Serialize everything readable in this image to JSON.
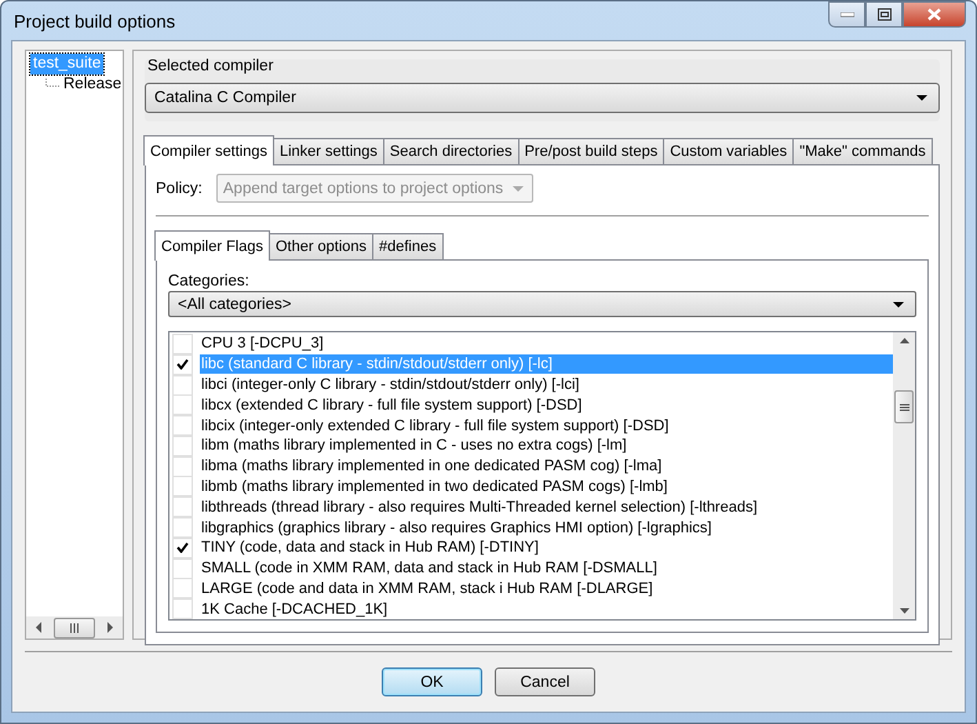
{
  "window": {
    "title": "Project build options"
  },
  "tree": [
    {
      "label": "test_suite",
      "selected": true,
      "children": [
        {
          "label": "Release",
          "selected": false
        }
      ]
    }
  ],
  "selected_compiler": {
    "label": "Selected compiler",
    "value": "Catalina C Compiler"
  },
  "tabs": [
    {
      "label": "Compiler settings",
      "selected": true
    },
    {
      "label": "Linker settings",
      "selected": false
    },
    {
      "label": "Search directories",
      "selected": false
    },
    {
      "label": "Pre/post build steps",
      "selected": false
    },
    {
      "label": "Custom variables",
      "selected": false
    },
    {
      "label": "\"Make\" commands",
      "selected": false
    }
  ],
  "policy": {
    "label": "Policy:",
    "value": "Append target options to project options",
    "disabled": true
  },
  "sub_tabs": [
    {
      "label": "Compiler Flags",
      "selected": true
    },
    {
      "label": "Other options",
      "selected": false
    },
    {
      "label": "#defines",
      "selected": false
    }
  ],
  "categories": {
    "label": "Categories:",
    "value": "<All categories>"
  },
  "flags": [
    {
      "label": "CPU 3  [-DCPU_3]",
      "checked": false,
      "selected": false
    },
    {
      "label": "libc (standard C library - stdin/stdout/stderr only)  [-lc]",
      "checked": true,
      "selected": true
    },
    {
      "label": "libci (integer-only C library - stdin/stdout/stderr only)  [-lci]",
      "checked": false,
      "selected": false
    },
    {
      "label": "libcx (extended C library - full file system support)  [-DSD]",
      "checked": false,
      "selected": false
    },
    {
      "label": "libcix (integer-only extended C library - full file system support)  [-DSD]",
      "checked": false,
      "selected": false
    },
    {
      "label": "libm (maths library implemented in C - uses no extra cogs)  [-lm]",
      "checked": false,
      "selected": false
    },
    {
      "label": "libma (maths library implemented in one dedicated PASM cog)  [-lma]",
      "checked": false,
      "selected": false
    },
    {
      "label": "libmb (maths library implemented in two dedicated PASM cogs)  [-lmb]",
      "checked": false,
      "selected": false
    },
    {
      "label": "libthreads (thread library - also requires Multi-Threaded kernel selection)  [-lthreads]",
      "checked": false,
      "selected": false
    },
    {
      "label": "libgraphics (graphics library - also requires Graphics HMI option)  [-lgraphics]",
      "checked": false,
      "selected": false
    },
    {
      "label": "TINY (code, data and stack in Hub RAM)  [-DTINY]",
      "checked": true,
      "selected": false
    },
    {
      "label": "SMALL (code in XMM RAM, data and stack in Hub RAM  [-DSMALL]",
      "checked": false,
      "selected": false
    },
    {
      "label": "LARGE (code and data in XMM RAM, stack i Hub RAM  [-DLARGE]",
      "checked": false,
      "selected": false
    },
    {
      "label": "1K Cache  [-DCACHED_1K]",
      "checked": false,
      "selected": false
    }
  ],
  "buttons": [
    {
      "label": "OK",
      "default": true
    },
    {
      "label": "Cancel",
      "default": false
    }
  ]
}
